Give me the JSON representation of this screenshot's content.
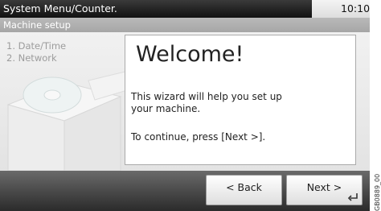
{
  "header": {
    "title": "System Menu/Counter.",
    "time": "10:10"
  },
  "subheader": {
    "title": "Machine setup"
  },
  "steps": [
    {
      "label": "1. Date/Time"
    },
    {
      "label": "2. Network"
    }
  ],
  "panel": {
    "heading": "Welcome!",
    "description": "This wizard will help you set up your machine.",
    "instruction": "To continue, press [Next >]."
  },
  "footer": {
    "back_label": "< Back",
    "next_label": "Next >"
  },
  "image_code": "GB0889_00",
  "icons": {
    "enter": "enter-return-icon",
    "illustration": "disc-box-illustration"
  },
  "colors": {
    "topbar": "#1e1e1e",
    "subbar": "#b0b0b0",
    "step_text": "#9c9c9c"
  }
}
